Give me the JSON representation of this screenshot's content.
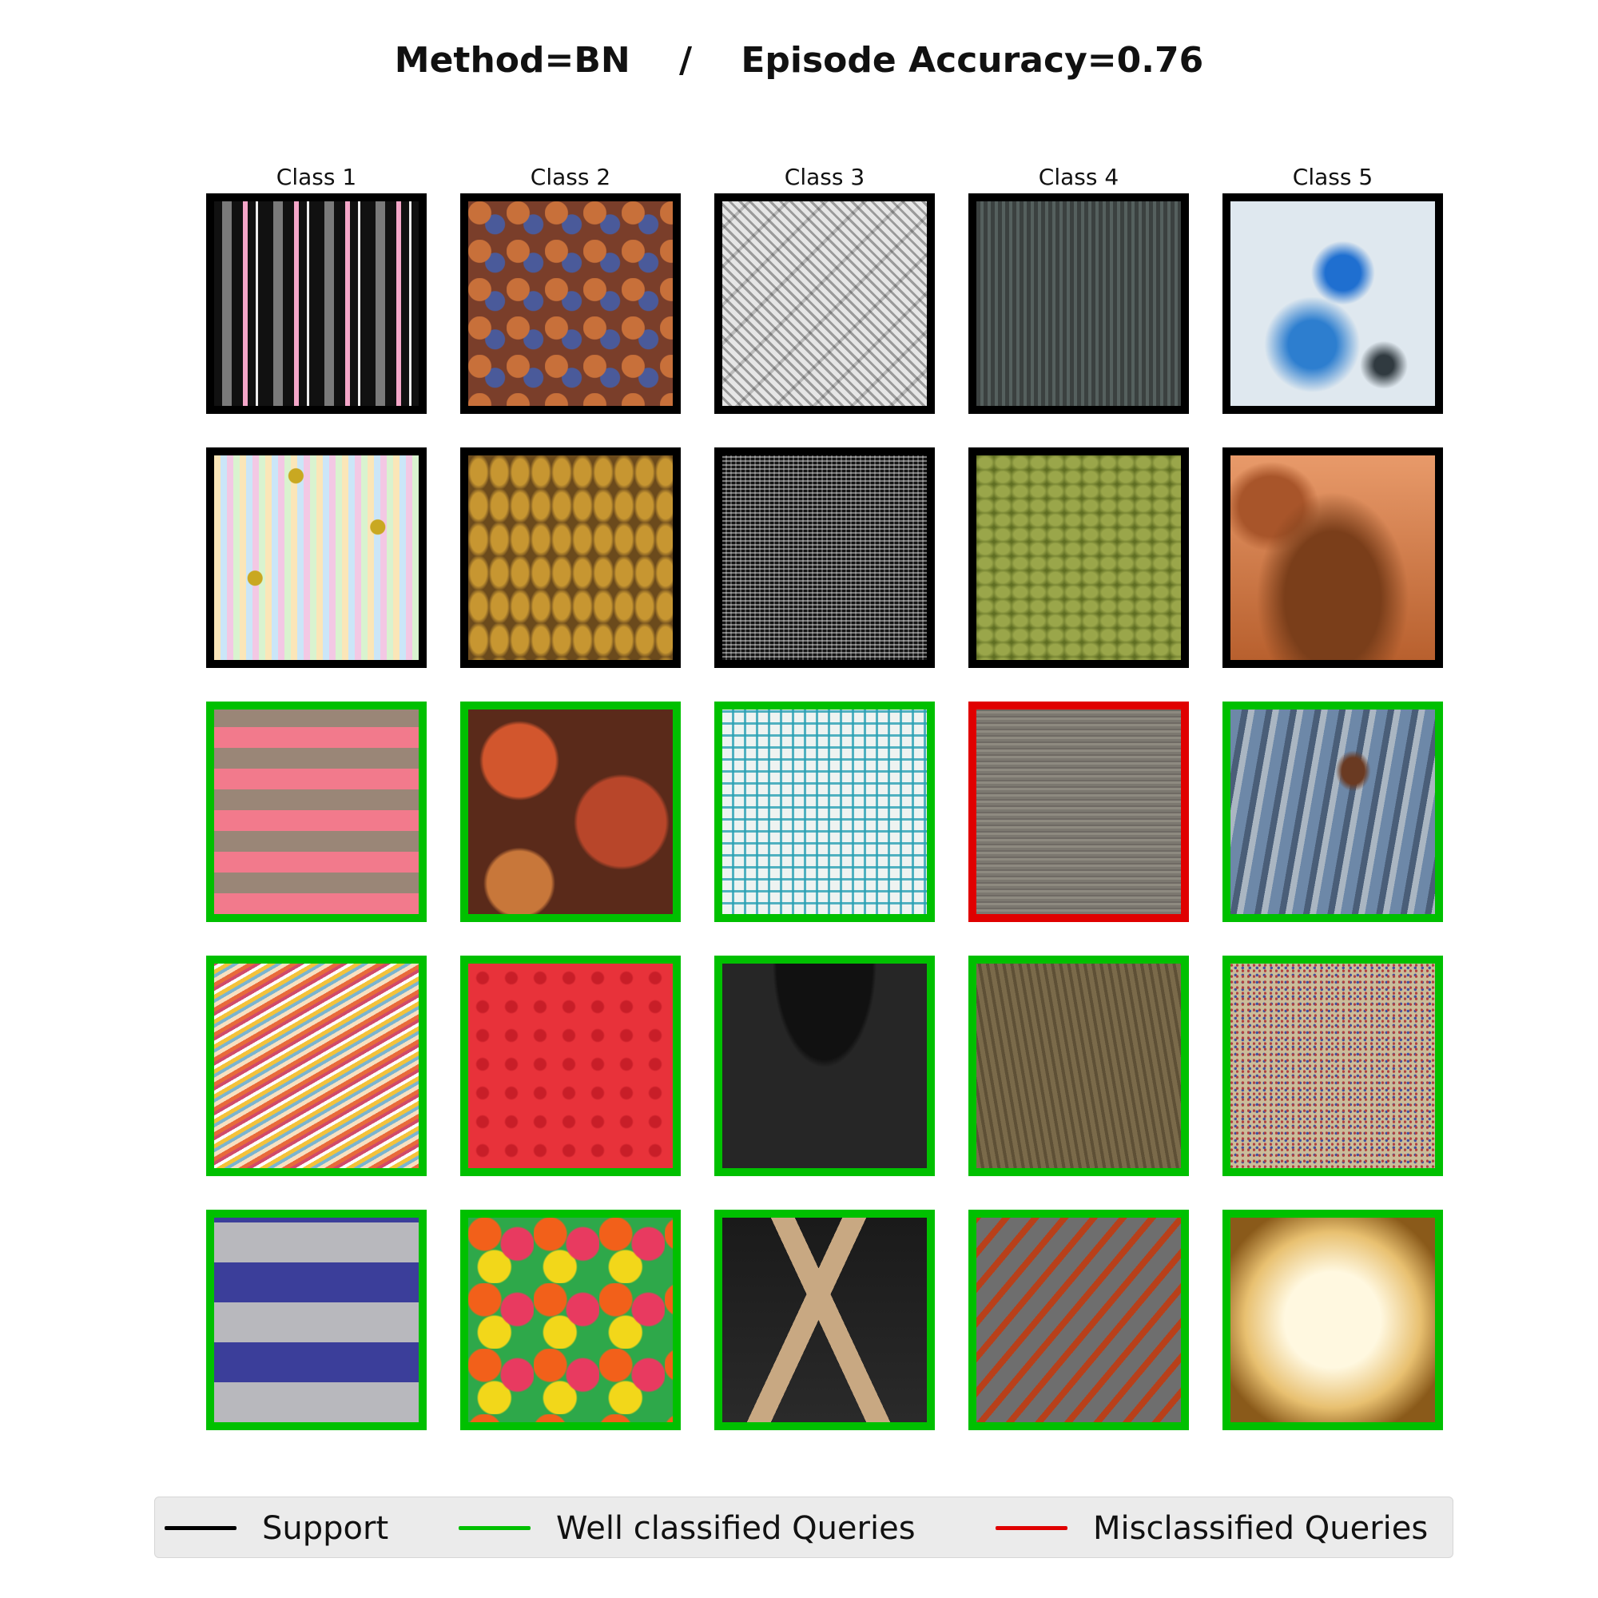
{
  "title": {
    "method": "Method=BN",
    "separator": "/",
    "accuracy": "Episode Accuracy=0.76"
  },
  "columns": [
    "Class 1",
    "Class 2",
    "Class 3",
    "Class 4",
    "Class 5"
  ],
  "colors": {
    "support": "#000000",
    "well": "#00c000",
    "mis": "#e00000"
  },
  "grid": [
    [
      "support",
      "support",
      "support",
      "support",
      "support"
    ],
    [
      "support",
      "support",
      "support",
      "support",
      "support"
    ],
    [
      "well",
      "well",
      "well",
      "mis",
      "well"
    ],
    [
      "well",
      "well",
      "well",
      "well",
      "well"
    ],
    [
      "well",
      "well",
      "well",
      "well",
      "well"
    ]
  ],
  "legend": [
    {
      "label": "Support",
      "status": "support"
    },
    {
      "label": "Well classified Queries",
      "status": "well"
    },
    {
      "label": "Misclassified Queries",
      "status": "mis"
    }
  ]
}
